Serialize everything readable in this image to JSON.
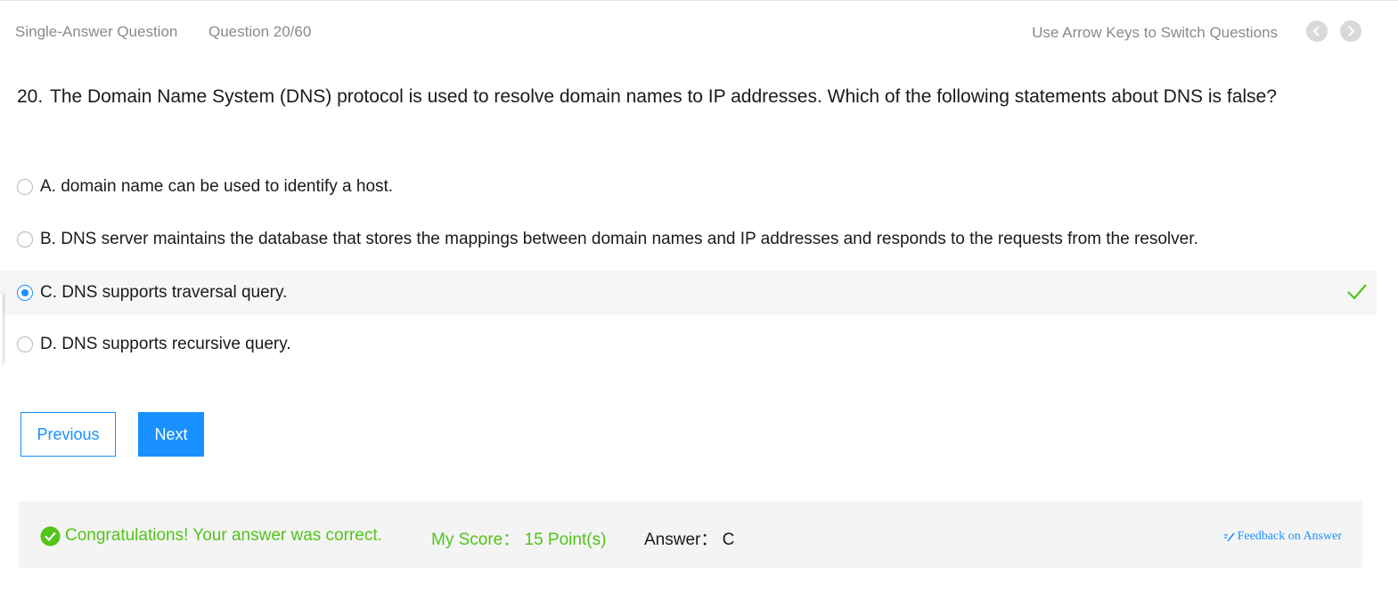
{
  "header": {
    "question_type": "Single-Answer Question",
    "question_counter": "Question 20/60",
    "hint": "Use Arrow Keys to Switch Questions",
    "prev_icon": "chevron-left-icon",
    "next_icon": "chevron-right-icon"
  },
  "question": {
    "number": "20.",
    "text": "The Domain Name System (DNS) protocol is used to resolve domain names to IP addresses. Which of the following statements about DNS is false?"
  },
  "options": [
    {
      "label": "A. domain name can be used to identify a host.",
      "selected": false
    },
    {
      "label": "B. DNS server maintains the database that stores the mappings between domain names and IP addresses and responds to the requests from the resolver.",
      "selected": false
    },
    {
      "label": "C. DNS supports traversal query.",
      "selected": true,
      "marked_correct": true
    },
    {
      "label": "D. DNS supports recursive query.",
      "selected": false
    }
  ],
  "buttons": {
    "previous": "Previous",
    "next": "Next"
  },
  "result": {
    "message": "Congratulations! Your answer was correct.",
    "score": "My Score： 15 Point(s)",
    "answer": "Answer： C",
    "feedback": "Feedback on Answer"
  },
  "colors": {
    "accent": "#1890ff",
    "success": "#52c41a",
    "muted_text": "#8a8a8a"
  }
}
